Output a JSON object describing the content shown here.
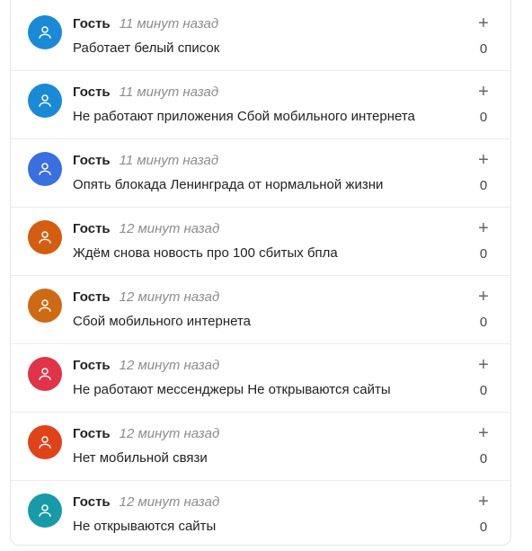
{
  "comments": [
    {
      "author": "Гость",
      "time": "11 минут назад",
      "text": "Работает белый список",
      "votes": "0",
      "avatar_color": "#1a8ad7"
    },
    {
      "author": "Гость",
      "time": "11 минут назад",
      "text": "Не работают приложения Сбой мобильного интернета",
      "votes": "0",
      "avatar_color": "#1a8ad7"
    },
    {
      "author": "Гость",
      "time": "11 минут назад",
      "text": "Опять блокада Ленинграда от нормальной жизни",
      "votes": "0",
      "avatar_color": "#3a6fe0"
    },
    {
      "author": "Гость",
      "time": "12 минут назад",
      "text": "Ждём снова новость про 100 сбитых бпла",
      "votes": "0",
      "avatar_color": "#d45d12"
    },
    {
      "author": "Гость",
      "time": "12 минут назад",
      "text": "Сбой мобильного интернета",
      "votes": "0",
      "avatar_color": "#cf6a14"
    },
    {
      "author": "Гость",
      "time": "12 минут назад",
      "text": "Не работают мессенджеры Не открываются сайты",
      "votes": "0",
      "avatar_color": "#e03448"
    },
    {
      "author": "Гость",
      "time": "12 минут назад",
      "text": "Нет мобильной связи",
      "votes": "0",
      "avatar_color": "#e0431a"
    },
    {
      "author": "Гость",
      "time": "12 минут назад",
      "text": "Не открываются сайты",
      "votes": "0",
      "avatar_color": "#189aa8"
    }
  ],
  "vote_up_symbol": "+",
  "icons": {
    "avatar": "user-icon"
  }
}
